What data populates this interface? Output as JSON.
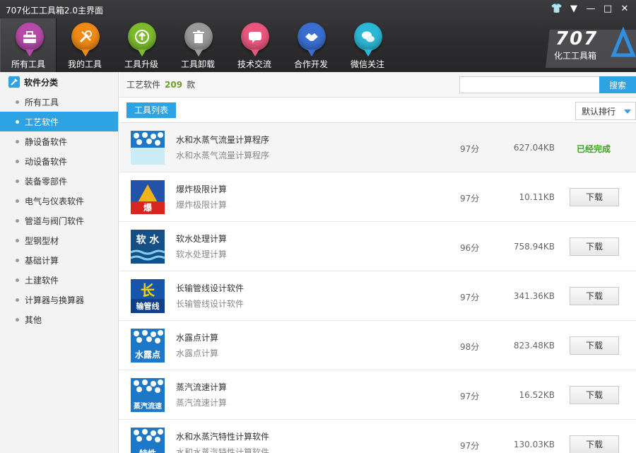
{
  "window": {
    "title": "707化工工具箱2.0主界面"
  },
  "toolbar": [
    {
      "label": "所有工具",
      "icon": "toolbox-icon",
      "color": "#b74aa9",
      "active": true
    },
    {
      "label": "我的工具",
      "icon": "wrench-icon",
      "color": "#f08a17"
    },
    {
      "label": "工具升级",
      "icon": "upgrade-arrow-icon",
      "color": "#7cbc2c"
    },
    {
      "label": "工具卸载",
      "icon": "trash-icon",
      "color": "#9a9a9a"
    },
    {
      "label": "技术交流",
      "icon": "chat-icon",
      "color": "#e8577d"
    },
    {
      "label": "合作开发",
      "icon": "handshake-icon",
      "color": "#3a6fd1"
    },
    {
      "label": "微信关注",
      "icon": "wechat-icon",
      "color": "#2cb7d6"
    }
  ],
  "brand": {
    "number": "707",
    "subtitle": "化工工具箱"
  },
  "sidebar": {
    "heading": "软件分类",
    "items": [
      {
        "label": "所有工具"
      },
      {
        "label": "工艺软件",
        "active": true
      },
      {
        "label": "静设备软件"
      },
      {
        "label": "动设备软件"
      },
      {
        "label": "装备零部件"
      },
      {
        "label": "电气与仪表软件"
      },
      {
        "label": "管道与阀门软件"
      },
      {
        "label": "型钢型材"
      },
      {
        "label": "基础计算"
      },
      {
        "label": "土建软件"
      },
      {
        "label": "计算器与换算器"
      },
      {
        "label": "其他"
      }
    ]
  },
  "main": {
    "category": "工艺软件",
    "count": "209",
    "count_unit": "款",
    "search": {
      "placeholder": "",
      "button": "搜索"
    },
    "tab": "工具列表",
    "sort": "默认排行",
    "download_label": "下载",
    "done_label": "已经完成",
    "apps": [
      {
        "name": "水和水蒸气流量计算程序",
        "desc": "水和水蒸气流量计算程序",
        "score": "97分",
        "size": "627.04KB",
        "icon_text": "",
        "status": "done"
      },
      {
        "name": "爆炸极限计算",
        "desc": "爆炸极限计算",
        "score": "97分",
        "size": "10.11KB",
        "icon_text": "爆",
        "status": "download"
      },
      {
        "name": "软水处理计算",
        "desc": "软水处理计算",
        "score": "96分",
        "size": "758.94KB",
        "icon_text": "软 水",
        "status": "download"
      },
      {
        "name": "长输管线设计软件",
        "desc": "长输管线设计软件",
        "score": "97分",
        "size": "341.36KB",
        "icon_text": "长",
        "icon_sub": "输管线",
        "status": "download"
      },
      {
        "name": "水露点计算",
        "desc": "水露点计算",
        "score": "98分",
        "size": "823.48KB",
        "icon_text": "水露点",
        "status": "download"
      },
      {
        "name": "蒸汽流速计算",
        "desc": "蒸汽流速计算",
        "score": "97分",
        "size": "16.52KB",
        "icon_text": "蒸汽流速",
        "status": "download"
      },
      {
        "name": "水和水蒸汽特性计算软件",
        "desc": "水和水蒸汽特性计算软件",
        "score": "97分",
        "size": "130.03KB",
        "icon_text": "特性",
        "status": "download"
      }
    ]
  }
}
